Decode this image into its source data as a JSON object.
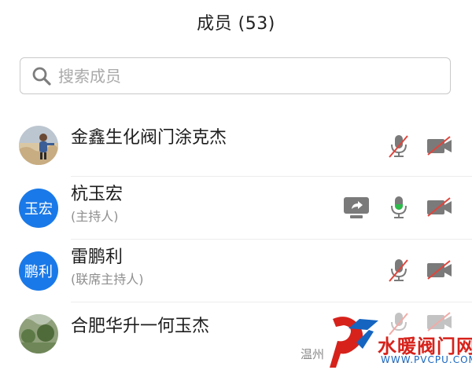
{
  "header": {
    "title": "成员 (53)"
  },
  "search": {
    "placeholder": "搜索成员"
  },
  "members": [
    {
      "name": "金鑫生化阀门涂克杰",
      "role": "",
      "avatar": "photo",
      "mic": "muted",
      "video": "off",
      "screen_share": false
    },
    {
      "name": "杭玉宏",
      "role": "(主持人)",
      "avatar_text": "玉宏",
      "mic": "active",
      "video": "off",
      "screen_share": true
    },
    {
      "name": "雷鹏利",
      "role": "(联席主持人)",
      "avatar_text": "鹏利",
      "mic": "muted",
      "video": "off",
      "screen_share": false
    },
    {
      "name": "合肥华升一何玉杰",
      "role": "",
      "avatar": "photo",
      "mic": "muted",
      "video": "off",
      "screen_share": false
    }
  ],
  "watermark": {
    "caption": "温州",
    "brand": "水暖阀门网",
    "url": "WWW.PVCPU.COM"
  },
  "colors": {
    "avatar_blue": "#1a79e8",
    "mute_slash": "#e0453c",
    "mic_active": "#2dbb4b",
    "icon_gray": "#7a7a7a"
  }
}
